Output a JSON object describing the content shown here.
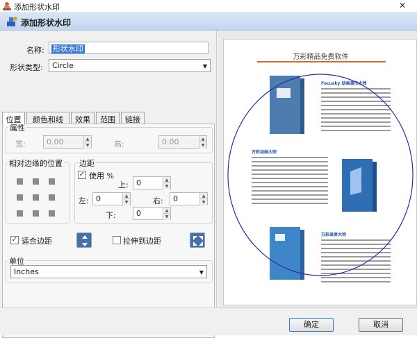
{
  "window": {
    "title": "添加形状水印",
    "close_glyph": "✕"
  },
  "header": {
    "title": "添加形状水印",
    "icon": "watermark-stamp-icon"
  },
  "form": {
    "name_label": "名称:",
    "name_value": "形状水印",
    "shape_type_label": "形状类型:",
    "shape_type_value": "Circle"
  },
  "tabs": [
    "位置",
    "颜色和线条",
    "效果",
    "范围",
    "链接"
  ],
  "position_tab": {
    "attributes_title": "属性",
    "width_label": "宽:",
    "width_value": "0.00",
    "height_label": "高:",
    "height_value": "0.00",
    "relative_edge_title": "相对边缘的位置",
    "margins_title": "边距",
    "use_label": "使用 %",
    "use_checked": true,
    "top_label": "上:",
    "top_value": "0",
    "left_label": "左:",
    "left_value": "0",
    "right_label": "右:",
    "right_value": "0",
    "bottom_label": "下:",
    "bottom_value": "0",
    "fit_margins_label": "适合边距",
    "fit_margins_checked": true,
    "stretch_label": "拉伸到边距",
    "stretch_checked": false,
    "unit_title": "单位",
    "unit_value": "Inches"
  },
  "preview": {
    "page_title": "万彩精品免费软件",
    "products": [
      "Focusky 动画演示大师",
      "万彩动画大师",
      "万彩录屏大师"
    ],
    "circle_color": "#2a2aa8"
  },
  "footer": {
    "ok_label": "确定",
    "cancel_label": "取消"
  },
  "colors": {
    "header_band": "#c9dbf1",
    "accent_blue": "#3b78d8",
    "box_blue": "#2f6db5"
  }
}
